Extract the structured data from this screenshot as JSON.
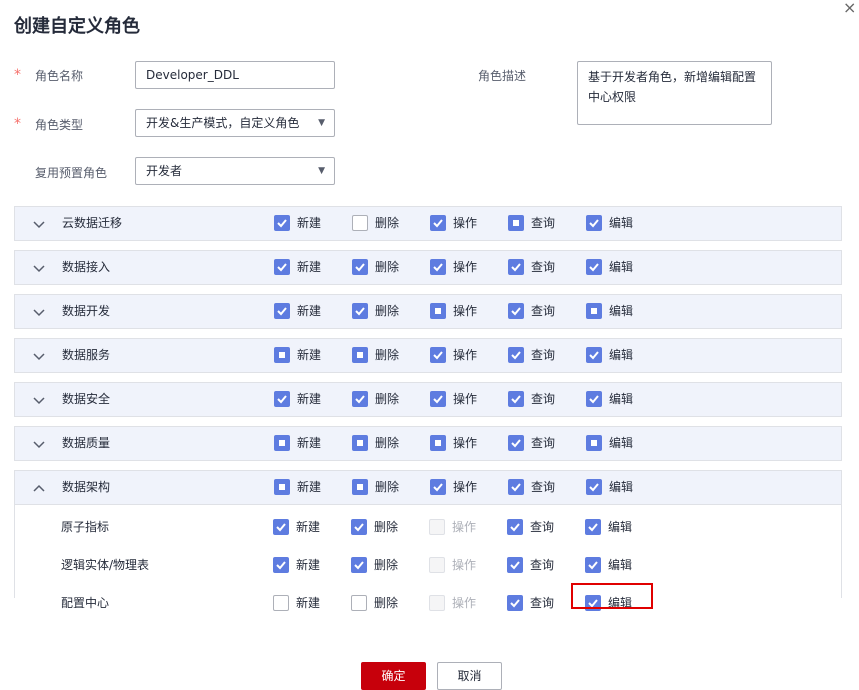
{
  "dialog": {
    "title": "创建自定义角色",
    "close_icon": "×"
  },
  "form": {
    "name_label": "角色名称",
    "name_value": "Developer_DDL",
    "type_label": "角色类型",
    "type_value": "开发&生产模式，自定义角色",
    "preset_label": "复用预置角色",
    "preset_value": "开发者",
    "desc_label": "角色描述",
    "desc_value": "基于开发者角色，新增编辑配置中心权限",
    "required_mark": "*"
  },
  "perm_labels": [
    "新建",
    "删除",
    "操作",
    "查询",
    "编辑"
  ],
  "groups": [
    {
      "name": "云数据迁移",
      "expanded": false,
      "states": [
        "checked",
        "unchecked",
        "checked",
        "indeterminate",
        "checked"
      ]
    },
    {
      "name": "数据接入",
      "expanded": false,
      "states": [
        "checked",
        "checked",
        "checked",
        "checked",
        "checked"
      ]
    },
    {
      "name": "数据开发",
      "expanded": false,
      "states": [
        "checked",
        "checked",
        "indeterminate",
        "checked",
        "indeterminate"
      ]
    },
    {
      "name": "数据服务",
      "expanded": false,
      "states": [
        "indeterminate",
        "indeterminate",
        "checked",
        "checked",
        "checked"
      ]
    },
    {
      "name": "数据安全",
      "expanded": false,
      "states": [
        "checked",
        "checked",
        "checked",
        "checked",
        "checked"
      ]
    },
    {
      "name": "数据质量",
      "expanded": false,
      "states": [
        "indeterminate",
        "indeterminate",
        "indeterminate",
        "checked",
        "indeterminate"
      ]
    },
    {
      "name": "数据架构",
      "expanded": true,
      "states": [
        "indeterminate",
        "indeterminate",
        "checked",
        "checked",
        "checked"
      ],
      "children": [
        {
          "name": "原子指标",
          "states": [
            "checked",
            "checked",
            "disabled",
            "checked",
            "checked"
          ]
        },
        {
          "name": "逻辑实体/物理表",
          "states": [
            "checked",
            "checked",
            "disabled",
            "checked",
            "checked"
          ]
        },
        {
          "name": "配置中心",
          "states": [
            "unchecked",
            "unchecked",
            "disabled",
            "checked",
            "checked"
          ],
          "highlight_index": 4
        }
      ]
    }
  ],
  "footer": {
    "ok_label": "确定",
    "cancel_label": "取消"
  },
  "colors": {
    "primary": "#5e7ce0",
    "danger": "#c7000b",
    "highlight": "#e00000"
  }
}
